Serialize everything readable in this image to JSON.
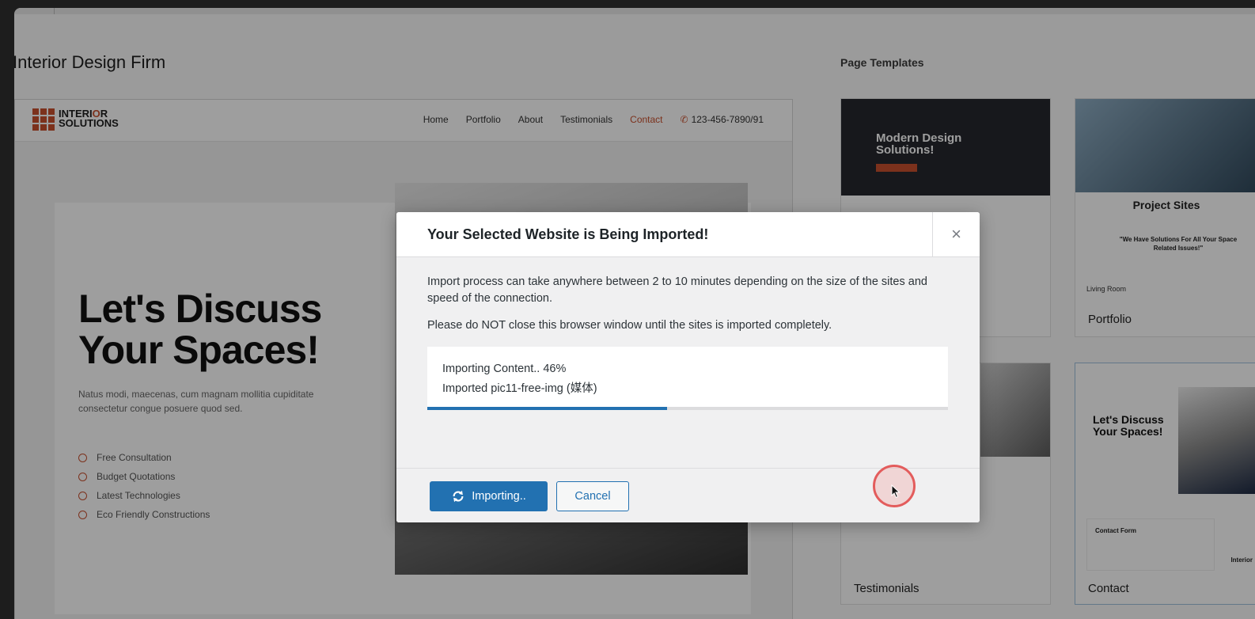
{
  "page": {
    "site_title": "Interior Design Firm",
    "templates_heading": "Page Templates"
  },
  "preview": {
    "logo_line1_pre": "INTERI",
    "logo_line1_o": "O",
    "logo_line1_post": "R",
    "logo_line2": "SOLUTIONS",
    "nav": [
      "Home",
      "Portfolio",
      "About",
      "Testimonials",
      "Contact"
    ],
    "phone": "123-456-7890/91",
    "hero_title": "Let's Discuss Your Spaces!",
    "hero_sub": "Natus modi, maecenas, cum magnam mollitia cupiditate consectetur congue posuere quod sed.",
    "features": [
      "Free Consultation",
      "Budget Quotations",
      "Latest Technologies",
      "Eco Friendly Constructions"
    ]
  },
  "templates": [
    {
      "label": "",
      "thumb_title": "Modern Design Solutions!"
    },
    {
      "label": "Portfolio",
      "thumb_title": "Project Sites",
      "thumb_quote": "\"We Have Solutions For All Your Space Related Issues!\"",
      "thumb_room": "Living Room"
    },
    {
      "label": "Testimonials"
    },
    {
      "label": "Contact",
      "thumb_title": "Let's Discuss Your Spaces!",
      "thumb_form": "Contact Form",
      "thumb_interior": "Interior"
    }
  ],
  "modal": {
    "title": "Your Selected Website is Being Imported!",
    "close_glyph": "×",
    "description": "Import process can take anywhere between 2 to 10 minutes depending on the size of the sites and speed of the connection.",
    "warning": "Please do NOT close this browser window until the sites is imported completely.",
    "status_line1": "Importing Content.. 46%",
    "status_line2": "Imported pic11-free-img (媒体)",
    "progress_percent": 46,
    "primary_button": "Importing..",
    "cancel_button": "Cancel"
  },
  "colors": {
    "accent": "#2271b1",
    "brand": "#c8502e"
  }
}
